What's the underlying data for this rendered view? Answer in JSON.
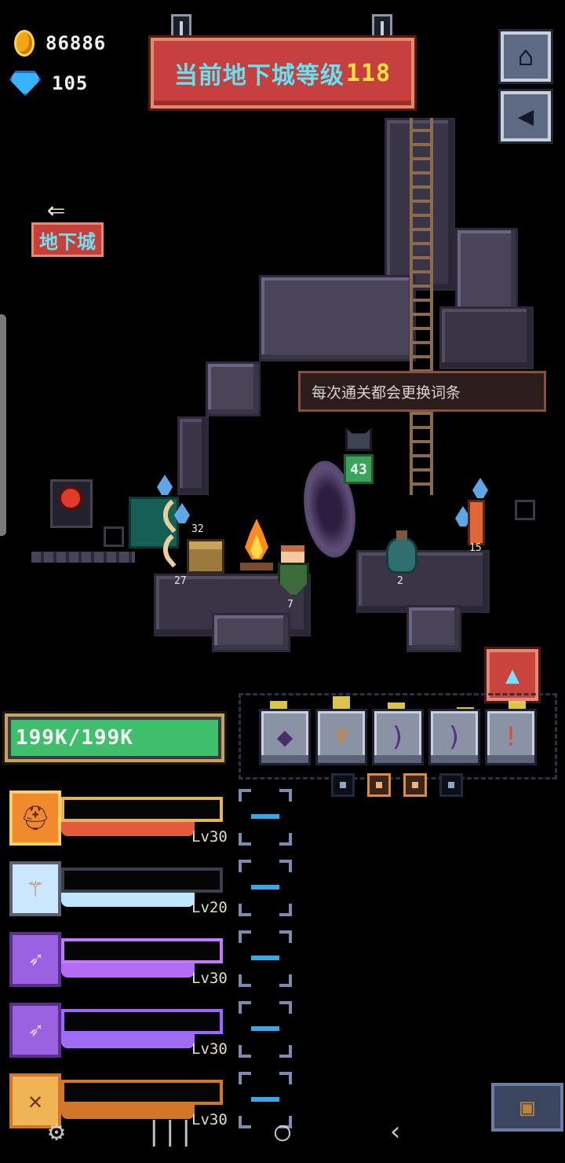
{
  "currency": {
    "gold": "86886",
    "gems": "105"
  },
  "banner": {
    "title": "当前地下城等级",
    "level": "118"
  },
  "buttons": {
    "home_icon": "home-icon",
    "sound_icon": "speaker-icon",
    "side_icon": "wizard-hat-icon",
    "chest_icon": "treasure-chest-icon"
  },
  "back": {
    "label": "地下城"
  },
  "tooltip": {
    "text": "每次通关都会更换词条"
  },
  "scene": {
    "counts": {
      "tusks": "32",
      "chest": "27",
      "shield": "7",
      "cat_badge": "43",
      "potion": "2",
      "torch": "15"
    }
  },
  "hp": {
    "text": "199K/199K",
    "fraction": 1.0
  },
  "weapons": [
    "shield-icon",
    "staff-icon",
    "bow-icon",
    "bow-icon",
    "torch-icon"
  ],
  "skills": [
    {
      "icon": "helmet-icon",
      "level": "Lv30",
      "color": "#f08a2c",
      "bar": "#e45a3c",
      "frame": "#e4b45a"
    },
    {
      "icon": "mace-icon",
      "level": "Lv20",
      "color": "#cbe6ff",
      "bar": "#bfe6ff",
      "frame": "#3a3f4d"
    },
    {
      "icon": "arrows-icon",
      "level": "Lv30",
      "color": "#9a62e0",
      "bar": "#b46cf4",
      "frame": "#c477ff"
    },
    {
      "icon": "arrows-icon",
      "level": "Lv30",
      "color": "#9a62e0",
      "bar": "#a06cf4",
      "frame": "#9b67ff"
    },
    {
      "icon": "wings-icon",
      "level": "Lv30",
      "color": "#f0b454",
      "bar": "#d2762a",
      "frame": "#d2762a"
    }
  ],
  "colors": {
    "accent_red": "#c5403e",
    "title_cyan": "#62e4f2",
    "level_yellow": "#ffe33b",
    "hp_green": "#3fbf6c"
  }
}
